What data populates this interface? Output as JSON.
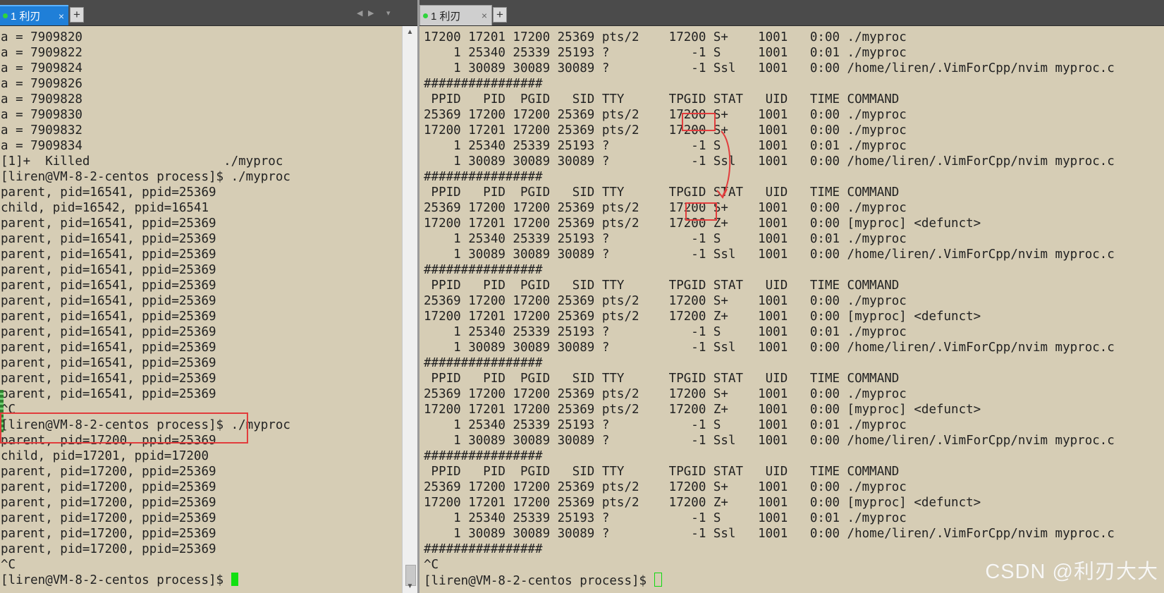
{
  "tabs": {
    "left": {
      "label": "1 利刃",
      "close": "×",
      "add": "+"
    },
    "right": {
      "label": "1 利刃",
      "close": "×",
      "add": "+"
    }
  },
  "nav": {
    "prev": "◀",
    "next": "▶",
    "menu": "▾"
  },
  "scrollbar": {
    "up": "▲",
    "down": "▼"
  },
  "left_terminal": {
    "lines": [
      "a = 7909820",
      "a = 7909822",
      "a = 7909824",
      "a = 7909826",
      "a = 7909828",
      "a = 7909830",
      "a = 7909832",
      "a = 7909834",
      "[1]+  Killed                  ./myproc",
      "[liren@VM-8-2-centos process]$ ./myproc",
      "parent, pid=16541, ppid=25369",
      "child, pid=16542, ppid=16541",
      "parent, pid=16541, ppid=25369",
      "parent, pid=16541, ppid=25369",
      "parent, pid=16541, ppid=25369",
      "parent, pid=16541, ppid=25369",
      "parent, pid=16541, ppid=25369",
      "parent, pid=16541, ppid=25369",
      "parent, pid=16541, ppid=25369",
      "parent, pid=16541, ppid=25369",
      "parent, pid=16541, ppid=25369",
      "parent, pid=16541, ppid=25369",
      "parent, pid=16541, ppid=25369",
      "parent, pid=16541, ppid=25369",
      "^C",
      "[liren@VM-8-2-centos process]$ ./myproc",
      "parent, pid=17200, ppid=25369",
      "child, pid=17201, ppid=17200",
      "parent, pid=17200, ppid=25369",
      "parent, pid=17200, ppid=25369",
      "parent, pid=17200, ppid=25369",
      "parent, pid=17200, ppid=25369",
      "parent, pid=17200, ppid=25369",
      "parent, pid=17200, ppid=25369",
      "^C"
    ],
    "prompt": "[liren@VM-8-2-centos process]$ "
  },
  "right_terminal": {
    "lines": [
      "17200 17201 17200 25369 pts/2    17200 S+    1001   0:00 ./myproc",
      "    1 25340 25339 25193 ?           -1 S     1001   0:01 ./myproc",
      "    1 30089 30089 30089 ?           -1 Ssl   1001   0:00 /home/liren/.VimForCpp/nvim myproc.c",
      "################",
      " PPID   PID  PGID   SID TTY      TPGID STAT   UID   TIME COMMAND",
      "25369 17200 17200 25369 pts/2    17200 S+    1001   0:00 ./myproc",
      "17200 17201 17200 25369 pts/2    17200 S+    1001   0:00 ./myproc",
      "    1 25340 25339 25193 ?           -1 S     1001   0:01 ./myproc",
      "    1 30089 30089 30089 ?           -1 Ssl   1001   0:00 /home/liren/.VimForCpp/nvim myproc.c",
      "################",
      " PPID   PID  PGID   SID TTY      TPGID STAT   UID   TIME COMMAND",
      "25369 17200 17200 25369 pts/2    17200 S+    1001   0:00 ./myproc",
      "17200 17201 17200 25369 pts/2    17200 Z+    1001   0:00 [myproc] <defunct>",
      "    1 25340 25339 25193 ?           -1 S     1001   0:01 ./myproc",
      "    1 30089 30089 30089 ?           -1 Ssl   1001   0:00 /home/liren/.VimForCpp/nvim myproc.c",
      "################",
      " PPID   PID  PGID   SID TTY      TPGID STAT   UID   TIME COMMAND",
      "25369 17200 17200 25369 pts/2    17200 S+    1001   0:00 ./myproc",
      "17200 17201 17200 25369 pts/2    17200 Z+    1001   0:00 [myproc] <defunct>",
      "    1 25340 25339 25193 ?           -1 S     1001   0:01 ./myproc",
      "    1 30089 30089 30089 ?           -1 Ssl   1001   0:00 /home/liren/.VimForCpp/nvim myproc.c",
      "################",
      " PPID   PID  PGID   SID TTY      TPGID STAT   UID   TIME COMMAND",
      "25369 17200 17200 25369 pts/2    17200 S+    1001   0:00 ./myproc",
      "17200 17201 17200 25369 pts/2    17200 Z+    1001   0:00 [myproc] <defunct>",
      "    1 25340 25339 25193 ?           -1 S     1001   0:01 ./myproc",
      "    1 30089 30089 30089 ?           -1 Ssl   1001   0:00 /home/liren/.VimForCpp/nvim myproc.c",
      "################",
      " PPID   PID  PGID   SID TTY      TPGID STAT   UID   TIME COMMAND",
      "25369 17200 17200 25369 pts/2    17200 S+    1001   0:00 ./myproc",
      "17200 17201 17200 25369 pts/2    17200 Z+    1001   0:00 [myproc] <defunct>",
      "    1 25340 25339 25193 ?           -1 S     1001   0:01 ./myproc",
      "    1 30089 30089 30089 ?           -1 Ssl   1001   0:00 /home/liren/.VimForCpp/nvim myproc.c",
      "################",
      "^C"
    ],
    "prompt": "[liren@VM-8-2-centos process]$ "
  },
  "watermark": "CSDN @利刃大大",
  "colors": {
    "terminal_bg": "#d6cdb5",
    "terminal_fg": "#222222",
    "tab_active": "#1f7fd8",
    "cursor": "#11e011",
    "highlight": "#e23c3c"
  }
}
